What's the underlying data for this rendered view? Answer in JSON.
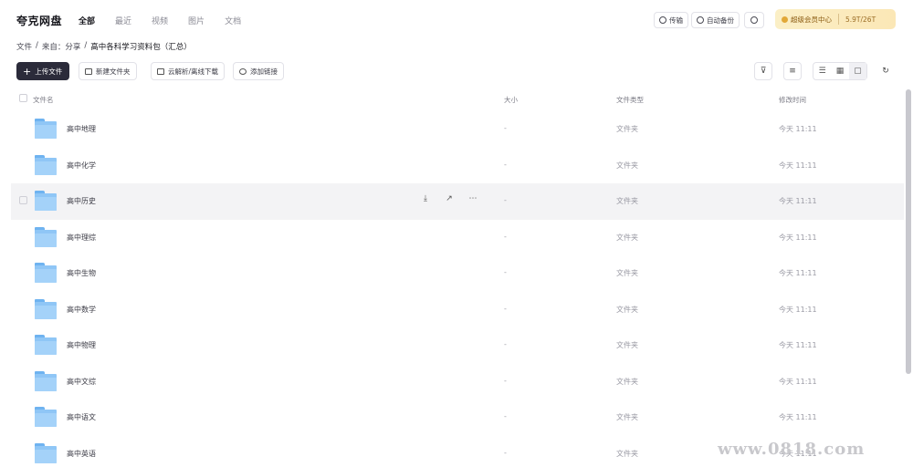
{
  "app": {
    "logo": "夸克网盘"
  },
  "nav": {
    "tabs": [
      {
        "label": "全部",
        "active": true
      },
      {
        "label": "最近"
      },
      {
        "label": "视频"
      },
      {
        "label": "图片"
      },
      {
        "label": "文档"
      }
    ]
  },
  "header": {
    "transfer_label": "传输",
    "backup_label": "自动备份",
    "vip_label": "超级会员中心",
    "storage": "5.9T/26T"
  },
  "breadcrumb": {
    "items": [
      "文件",
      "来自：分享",
      "高中各科学习资料包（汇总）"
    ],
    "sep": "/"
  },
  "toolbar": {
    "upload_label": "上传文件",
    "new_folder_label": "新建文件夹",
    "offline_label": "云解析/离线下载",
    "add_label": "添加链接"
  },
  "table": {
    "columns": {
      "name": "文件名",
      "size": "大小",
      "type": "文件类型",
      "time": "修改时间"
    },
    "rows": [
      {
        "name": "高中地理",
        "size": "-",
        "type": "文件夹",
        "time": "今天 11:11"
      },
      {
        "name": "高中化学",
        "size": "-",
        "type": "文件夹",
        "time": "今天 11:11"
      },
      {
        "name": "高中历史",
        "size": "-",
        "type": "文件夹",
        "time": "今天 11:11"
      },
      {
        "name": "高中理综",
        "size": "-",
        "type": "文件夹",
        "time": "今天 11:11"
      },
      {
        "name": "高中生物",
        "size": "-",
        "type": "文件夹",
        "time": "今天 11:11"
      },
      {
        "name": "高中数学",
        "size": "-",
        "type": "文件夹",
        "time": "今天 11:11"
      },
      {
        "name": "高中物理",
        "size": "-",
        "type": "文件夹",
        "time": "今天 11:11"
      },
      {
        "name": "高中文综",
        "size": "-",
        "type": "文件夹",
        "time": "今天 11:11"
      },
      {
        "name": "高中语文",
        "size": "-",
        "type": "文件夹",
        "time": "今天 11:11"
      },
      {
        "name": "高中英语",
        "size": "-",
        "type": "文件夹",
        "time": "今天 11:11"
      }
    ]
  },
  "watermark": "www.0818.com",
  "colors": {
    "accent": "#2b2b3a",
    "folder": "#8fc6f6",
    "vip_bg": "#fbefc6"
  }
}
